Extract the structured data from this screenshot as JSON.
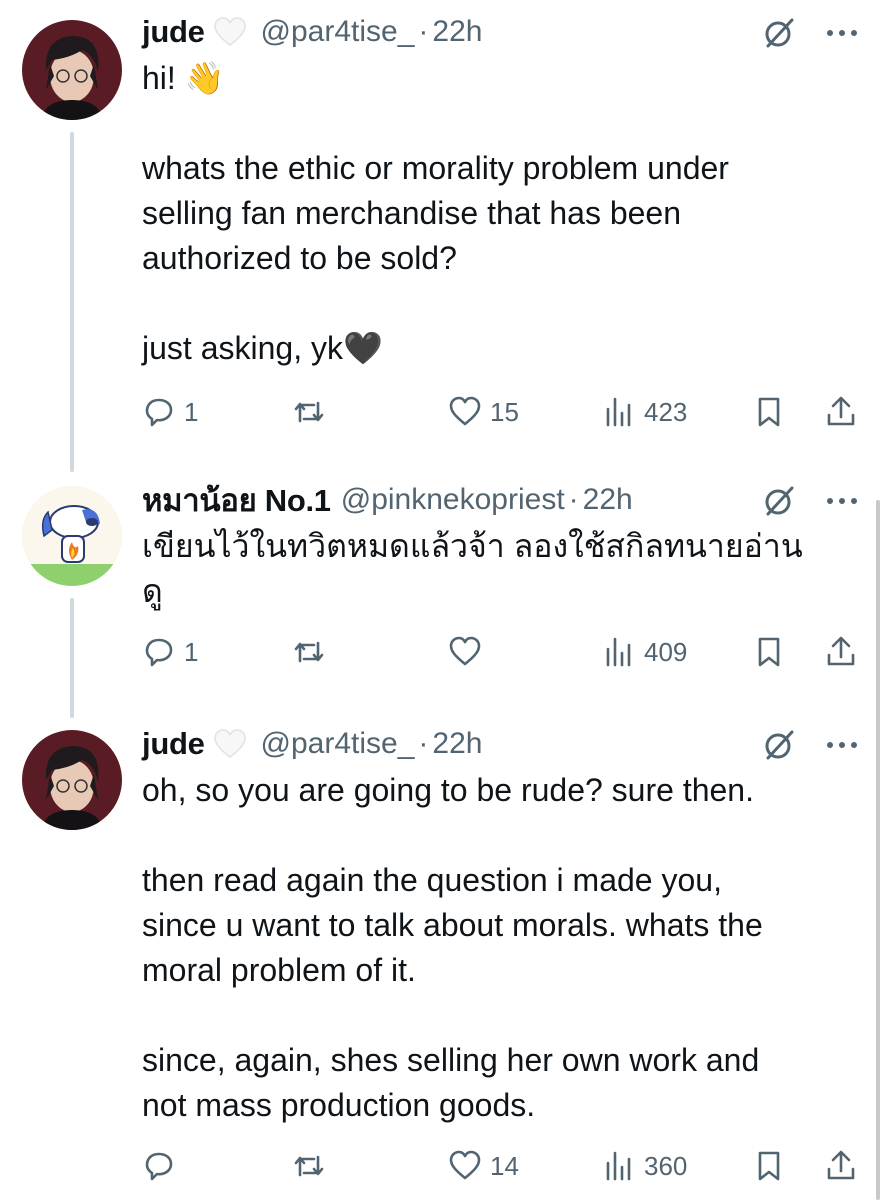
{
  "tweets": [
    {
      "name": "jude",
      "handle": "@par4tise_",
      "dot": "·",
      "time": "22h",
      "text": "hi! 👋\n\nwhats the ethic or morality problem under\nselling fan merchandise that has been\nauthorized to be sold?\n\njust asking, yk🖤",
      "replies": "1",
      "retweets": "",
      "likes": "15",
      "views": "423",
      "avatar": "dark-hair-avatar"
    },
    {
      "name": "หมาน้อย No.1",
      "handle": "@pinknekopriest",
      "dot": "·",
      "time": "22h",
      "text": "เขียนไว้ในทวิตหมดแล้วจ้า ลองใช้สกิลทนายอ่าน\nดู",
      "replies": "1",
      "retweets": "",
      "likes": "",
      "views": "409",
      "avatar": "dog-on-fire-avatar"
    },
    {
      "name": "jude",
      "handle": "@par4tise_",
      "dot": "·",
      "time": "22h",
      "text": "oh, so you are going to be rude? sure then.\n\nthen read again the question i made you,\nsince u want to talk about morals. whats the\nmoral problem of it.\n\nsince, again, shes selling her own work and\nnot mass production goods.",
      "replies": "",
      "retweets": "",
      "likes": "14",
      "views": "360",
      "avatar": "dark-hair-avatar"
    }
  ],
  "icons": {
    "reply": "reply-icon",
    "retweet": "retweet-icon",
    "like": "heart-icon",
    "views": "views-icon",
    "bookmark": "bookmark-icon",
    "share": "share-icon",
    "grok": "grok-icon",
    "more": "more-icon",
    "badge": "white-heart-icon"
  },
  "colors": {
    "text": "#0f1419",
    "secondary": "#536471",
    "thread_line": "#cfd9de"
  }
}
